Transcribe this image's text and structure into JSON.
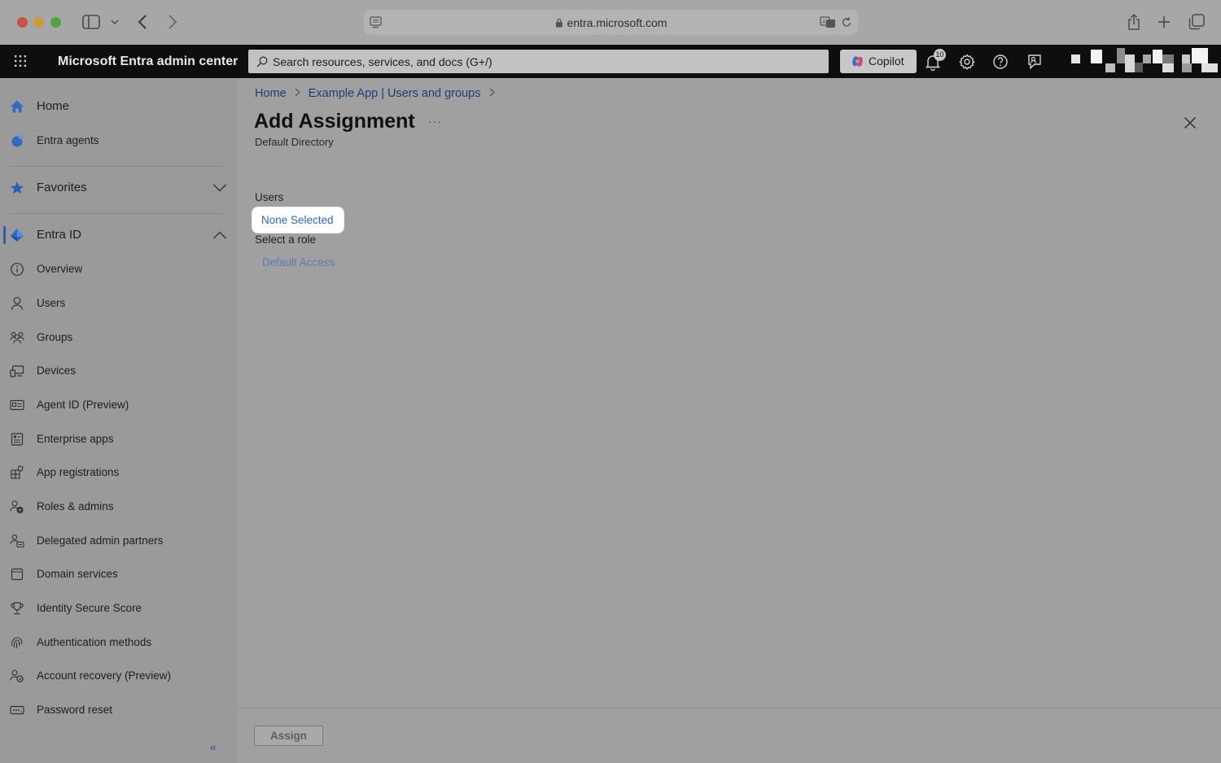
{
  "browser": {
    "url": "entra.microsoft.com"
  },
  "header": {
    "app_title": "Microsoft Entra admin center",
    "search_placeholder": "Search resources, services, and docs (G+/)",
    "copilot_label": "Copilot",
    "notification_count": "10"
  },
  "sidebar": {
    "top_items": [
      {
        "label": "Home",
        "icon": "home-icon"
      },
      {
        "label": "Entra agents",
        "icon": "entra-agents-icon"
      }
    ],
    "favorites_label": "Favorites",
    "section_label": "Entra ID",
    "items": [
      {
        "label": "Overview",
        "icon": "info-icon"
      },
      {
        "label": "Users",
        "icon": "user-icon"
      },
      {
        "label": "Groups",
        "icon": "groups-icon"
      },
      {
        "label": "Devices",
        "icon": "devices-icon"
      },
      {
        "label": "Agent ID (Preview)",
        "icon": "id-card-icon"
      },
      {
        "label": "Enterprise apps",
        "icon": "enterprise-apps-icon"
      },
      {
        "label": "App registrations",
        "icon": "app-registrations-icon"
      },
      {
        "label": "Roles & admins",
        "icon": "roles-icon"
      },
      {
        "label": "Delegated admin partners",
        "icon": "partners-icon"
      },
      {
        "label": "Domain services",
        "icon": "domain-icon"
      },
      {
        "label": "Identity Secure Score",
        "icon": "trophy-icon"
      },
      {
        "label": "Authentication methods",
        "icon": "fingerprint-icon"
      },
      {
        "label": "Account recovery (Preview)",
        "icon": "account-recovery-icon"
      },
      {
        "label": "Password reset",
        "icon": "password-icon"
      }
    ],
    "collapse_glyph": "«"
  },
  "main": {
    "breadcrumb": [
      "Home",
      "Example App | Users and groups"
    ],
    "title": "Add Assignment",
    "more_glyph": "···",
    "subtitle": "Default Directory",
    "users_label": "Users",
    "users_value": "None Selected",
    "role_label": "Select a role",
    "role_value": "Default Access",
    "assign_label": "Assign"
  },
  "colors": {
    "accent": "#2f66c6",
    "header_bg": "#0e0e0e",
    "active_indicator": "#2f5da8"
  }
}
